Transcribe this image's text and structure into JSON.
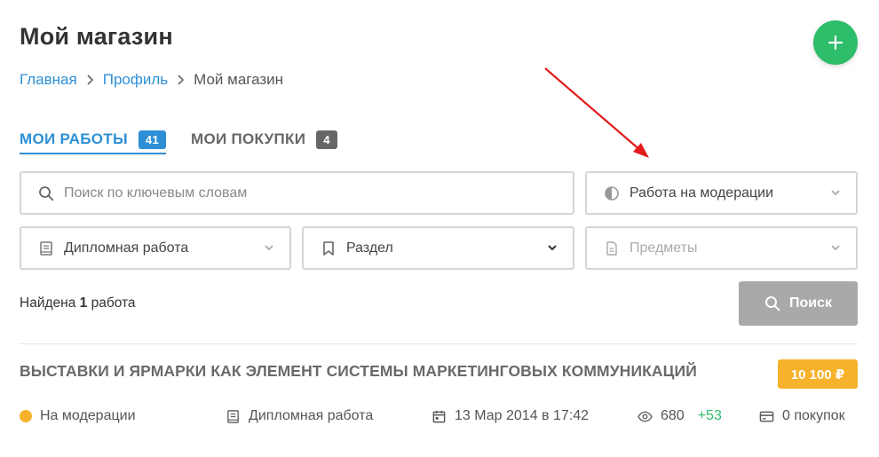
{
  "page": {
    "title": "Мой магазин"
  },
  "breadcrumb": [
    {
      "label": "Главная"
    },
    {
      "label": "Профиль"
    },
    {
      "label": "Мой магазин"
    }
  ],
  "tabs": [
    {
      "label": "МОИ РАБОТЫ",
      "count": "41"
    },
    {
      "label": "МОИ ПОКУПКИ",
      "count": "4"
    }
  ],
  "filters": {
    "search_placeholder": "Поиск по ключевым словам",
    "status_value": "Работа на модерации",
    "type_value": "Дипломная работа",
    "section_value": "Раздел",
    "subjects_placeholder": "Предметы"
  },
  "results": {
    "prefix": "Найдена",
    "count": "1",
    "suffix": "работа"
  },
  "search_button": {
    "label": "Поиск"
  },
  "work": {
    "title": "ВЫСТАВКИ И ЯРМАРКИ КАК ЭЛЕМЕНТ СИСТЕМЫ МАРКЕТИНГОВЫХ КОММУНИКАЦИЙ",
    "price": "10 100 ₽",
    "status": "На модерации",
    "type": "Дипломная работа",
    "date": "13 Мар 2014 в 17:42",
    "views": "680",
    "views_delta": "+53",
    "purchases": "0 покупок"
  },
  "colors": {
    "accent_blue": "#2e8fd6",
    "fab_green": "#2ebd6b",
    "price_orange": "#f7b22c",
    "annotation_red": "#e21b1b"
  },
  "icons": {
    "fab": "plus-icon",
    "search": "search-icon",
    "status": "half-circle-icon",
    "type": "book-icon",
    "section": "bookmark-icon",
    "subjects": "document-icon",
    "date": "calendar-icon",
    "views": "eye-icon",
    "purchases": "card-icon"
  }
}
